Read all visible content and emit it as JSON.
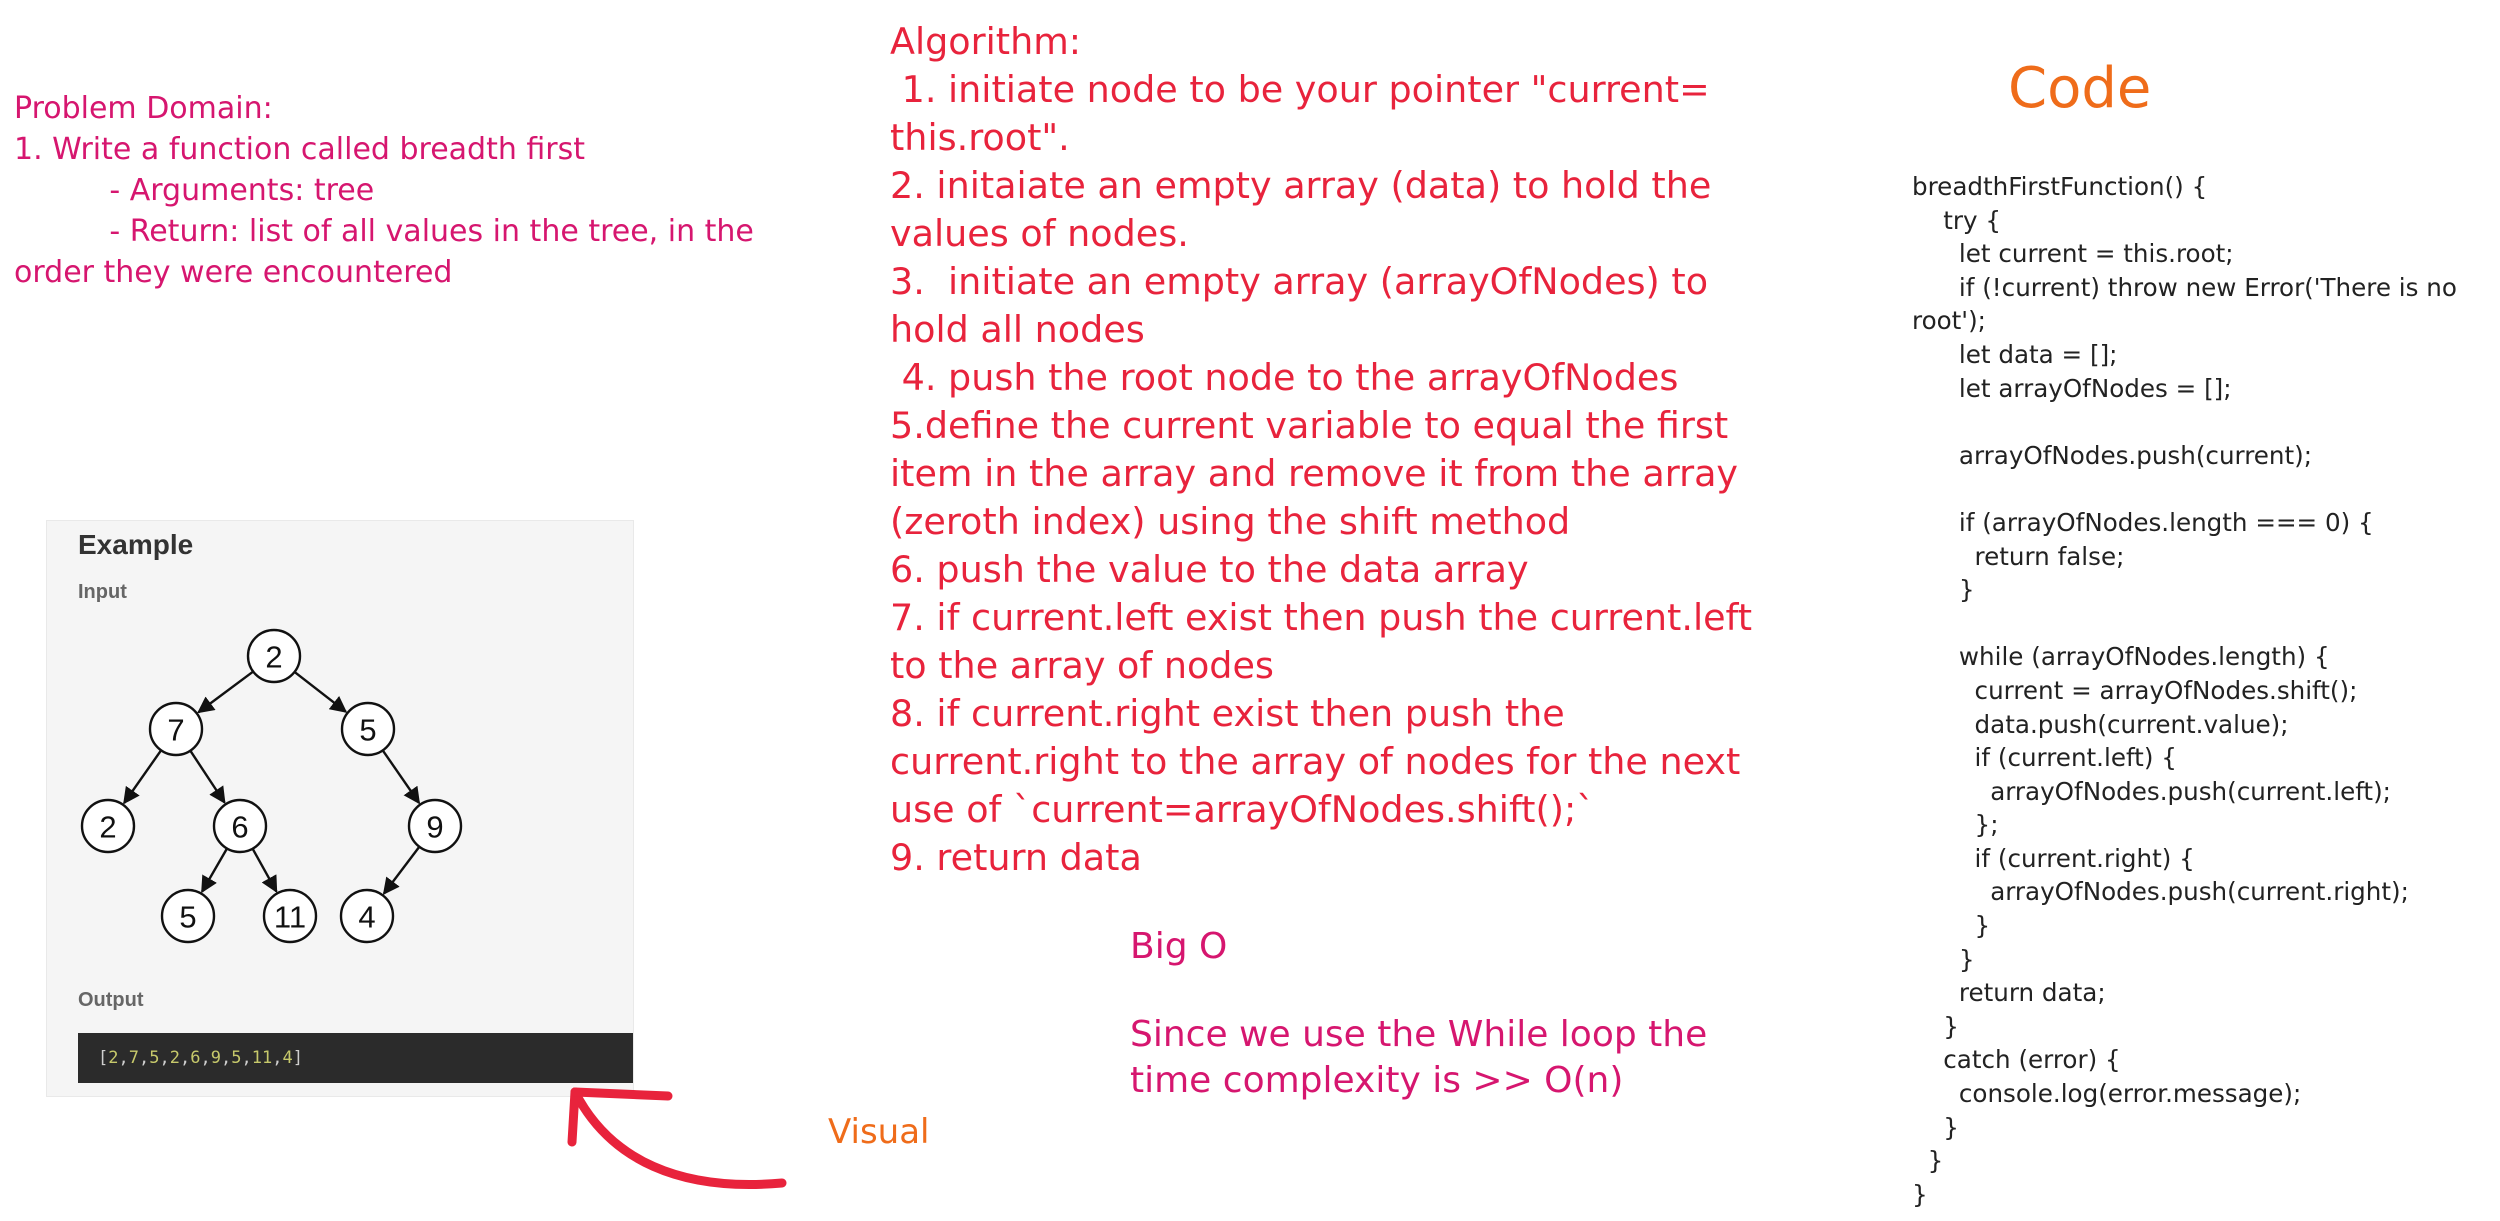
{
  "problem_domain": {
    "lines": [
      "Problem Domain:",
      "1. Write a function called breadth first",
      "          - Arguments: tree",
      "          - Return: list of all values in the tree, in the",
      "order they were encountered"
    ]
  },
  "algorithm": {
    "lines": [
      "Algorithm:",
      " 1. initiate node to be your pointer \"current= this.root\".",
      "2. initaiate an empty array (data) to hold the values of nodes.",
      "3.  initiate an empty array (arrayOfNodes) to hold all nodes",
      " 4. push the root node to the arrayOfNodes",
      "5.define the current variable to equal the first item in the array and remove it from the array (zeroth index) using the shift method",
      "6. push the value to the data array",
      "7. if current.left exist then push the current.left to the array of nodes",
      "8. if current.right exist then push the current.right to the array of nodes for the next use of `current=arrayOfNodes.shift();`",
      "9. return data"
    ]
  },
  "big_o": {
    "title": "Big O",
    "text": "Since we use the While loop the time complexity is >> O(n)"
  },
  "visual_label": "Visual",
  "code": {
    "title": "Code",
    "lines": [
      "breadthFirstFunction() {",
      "    try {",
      "      let current = this.root;",
      "      if (!current) throw new Error('There is no root');",
      "      let data = [];",
      "      let arrayOfNodes = [];",
      "",
      "      arrayOfNodes.push(current);",
      "",
      "      if (arrayOfNodes.length === 0) {",
      "        return false;",
      "      }",
      "",
      "      while (arrayOfNodes.length) {",
      "        current = arrayOfNodes.shift();",
      "        data.push(current.value);",
      "        if (current.left) {",
      "          arrayOfNodes.push(current.left);",
      "        };",
      "        if (current.right) {",
      "          arrayOfNodes.push(current.right);",
      "        }",
      "      }",
      "      return data;",
      "    }",
      "    catch (error) {",
      "      console.log(error.message);",
      "    }",
      "  }",
      "}"
    ]
  },
  "example": {
    "title": "Example",
    "input_label": "Input",
    "output_label": "Output",
    "tree_nodes": [
      {
        "id": "n2a",
        "label": "2"
      },
      {
        "id": "n7",
        "label": "7"
      },
      {
        "id": "n5a",
        "label": "5"
      },
      {
        "id": "n2b",
        "label": "2"
      },
      {
        "id": "n6",
        "label": "6"
      },
      {
        "id": "n9",
        "label": "9"
      },
      {
        "id": "n5b",
        "label": "5"
      },
      {
        "id": "n11",
        "label": "11"
      },
      {
        "id": "n4",
        "label": "4"
      }
    ],
    "tree_edges": [
      [
        "n2a",
        "n7"
      ],
      [
        "n2a",
        "n5a"
      ],
      [
        "n7",
        "n2b"
      ],
      [
        "n7",
        "n6"
      ],
      [
        "n5a",
        "n9"
      ],
      [
        "n6",
        "n5b"
      ],
      [
        "n6",
        "n11"
      ],
      [
        "n9",
        "n4"
      ]
    ],
    "output_values": [
      "2",
      "7",
      "5",
      "2",
      "6",
      "9",
      "5",
      "11",
      "4"
    ]
  },
  "colors": {
    "problem": "#d6166f",
    "algorithm": "#e8233c",
    "accent_orange": "#ef6c1a",
    "arrow": "#e8233c"
  }
}
